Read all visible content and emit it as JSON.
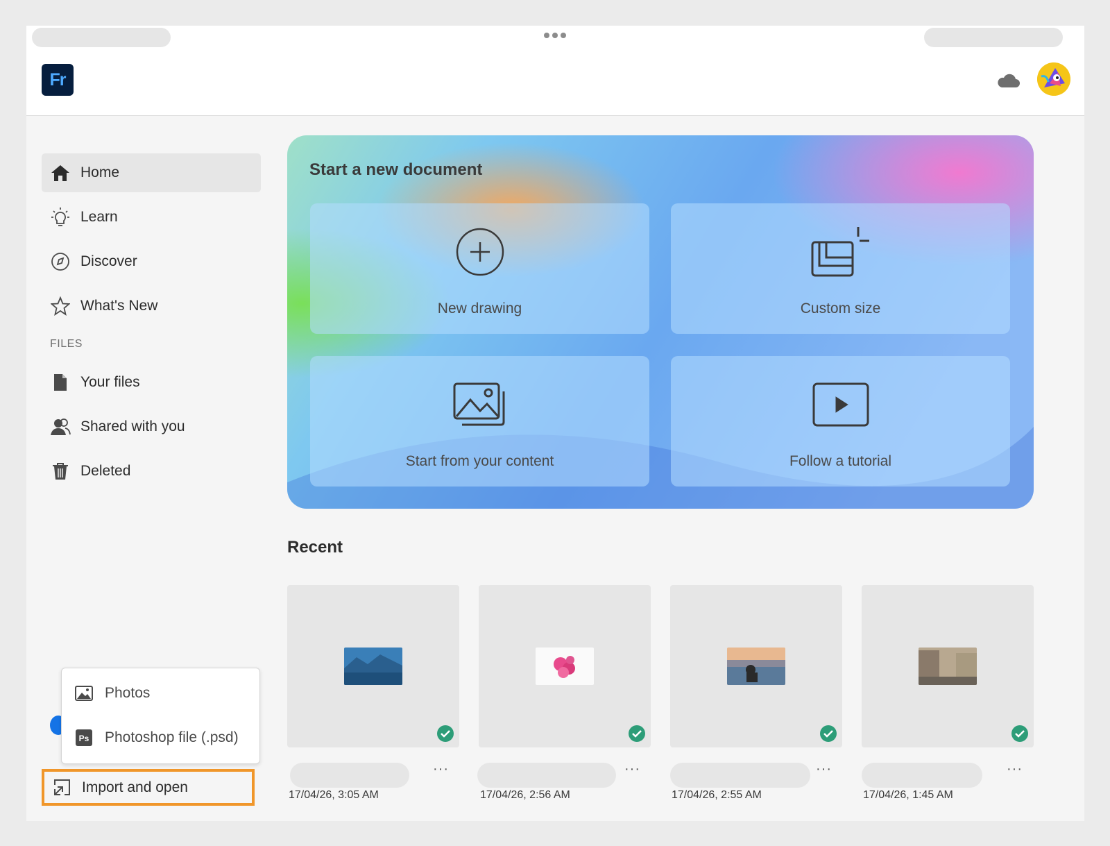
{
  "app": {
    "logo_text": "Fr"
  },
  "icons": {
    "cloud": "cloud-icon",
    "avatar": "avatar"
  },
  "sidebar": {
    "items": [
      {
        "label": "Home",
        "icon": "home-icon",
        "active": true
      },
      {
        "label": "Learn",
        "icon": "lightbulb-icon"
      },
      {
        "label": "Discover",
        "icon": "compass-icon"
      },
      {
        "label": "What's New",
        "icon": "star-icon"
      }
    ],
    "files_section": "FILES",
    "file_items": [
      {
        "label": "Your files",
        "icon": "file-icon"
      },
      {
        "label": "Shared with you",
        "icon": "users-icon"
      },
      {
        "label": "Deleted",
        "icon": "trash-icon"
      }
    ]
  },
  "popup": {
    "items": [
      {
        "label": "Photos",
        "icon": "image-icon"
      },
      {
        "label": "Photoshop file (.psd)",
        "icon": "photoshop-icon"
      }
    ]
  },
  "import": {
    "label": "Import and open"
  },
  "hero": {
    "title": "Start a new document",
    "cards": [
      {
        "label": "New drawing",
        "icon": "plus-circle-icon"
      },
      {
        "label": "Custom size",
        "icon": "custom-size-icon"
      },
      {
        "label": "Start from your content",
        "icon": "image-stack-icon"
      },
      {
        "label": "Follow a tutorial",
        "icon": "play-icon"
      }
    ]
  },
  "recent": {
    "title": "Recent",
    "items": [
      {
        "date": "17/04/26, 3:05 AM",
        "more": "···"
      },
      {
        "date": "17/04/26, 2:56 AM",
        "more": "···"
      },
      {
        "date": "17/04/26, 2:55 AM",
        "more": "···"
      },
      {
        "date": "17/04/26, 1:45 AM",
        "more": "···"
      }
    ]
  },
  "colors": {
    "accent": "#1473e6",
    "highlight": "#f0962a",
    "check": "#2d9d78"
  }
}
